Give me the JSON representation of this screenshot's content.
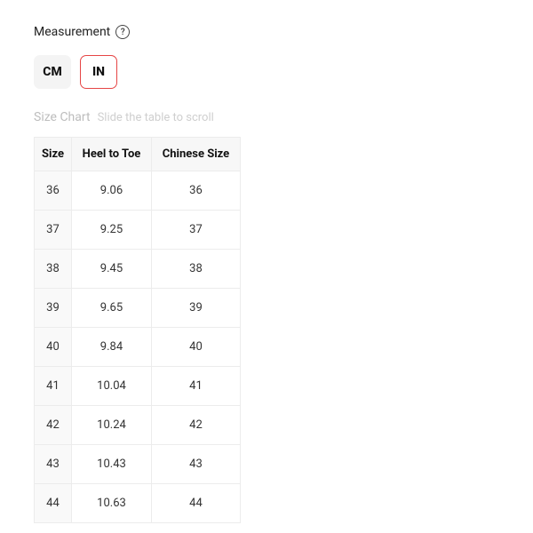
{
  "measurement": {
    "label": "Measurement",
    "help_icon": "?"
  },
  "units": {
    "cm_label": "CM",
    "in_label": "IN",
    "active": "IN"
  },
  "chart": {
    "title": "Size Chart",
    "hint": "Slide the table to scroll",
    "columns": [
      "Size",
      "Heel to Toe",
      "Chinese Size"
    ],
    "rows": [
      {
        "size": "36",
        "heel_to_toe": "9.06",
        "chinese_size": "36"
      },
      {
        "size": "37",
        "heel_to_toe": "9.25",
        "chinese_size": "37"
      },
      {
        "size": "38",
        "heel_to_toe": "9.45",
        "chinese_size": "38"
      },
      {
        "size": "39",
        "heel_to_toe": "9.65",
        "chinese_size": "39"
      },
      {
        "size": "40",
        "heel_to_toe": "9.84",
        "chinese_size": "40"
      },
      {
        "size": "41",
        "heel_to_toe": "10.04",
        "chinese_size": "41"
      },
      {
        "size": "42",
        "heel_to_toe": "10.24",
        "chinese_size": "42"
      },
      {
        "size": "43",
        "heel_to_toe": "10.43",
        "chinese_size": "43"
      },
      {
        "size": "44",
        "heel_to_toe": "10.63",
        "chinese_size": "44"
      }
    ]
  }
}
